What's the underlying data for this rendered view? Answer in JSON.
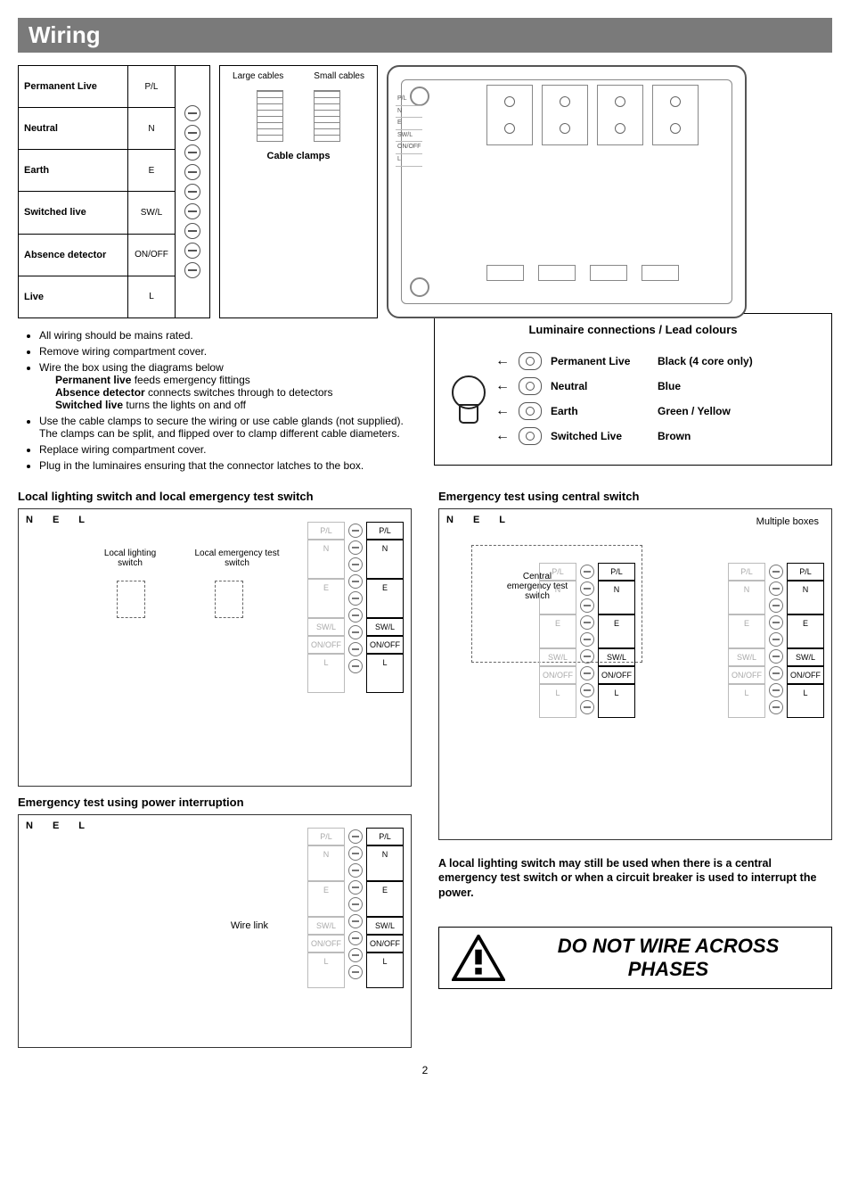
{
  "title": "Wiring",
  "page_number": "2",
  "terminals": [
    {
      "label": "Permanent Live",
      "abbr": "P/L"
    },
    {
      "label": "Neutral",
      "abbr": "N"
    },
    {
      "label": "Earth",
      "abbr": "E"
    },
    {
      "label": "Switched live",
      "abbr": "SW/L"
    },
    {
      "label": "Absence detector",
      "abbr": "ON/OFF"
    },
    {
      "label": "Live",
      "abbr": "L"
    }
  ],
  "clamp": {
    "large": "Large cables",
    "small": "Small cables",
    "title": "Cable clamps"
  },
  "bullets": [
    "All wiring should be mains rated.",
    "Remove wiring compartment cover.",
    "Wire the box using the diagrams below",
    "Use the cable clamps to secure the wiring or use cable glands (not supplied). The clamps can be split, and flipped over to clamp different cable diameters.",
    "Replace wiring compartment cover.",
    "Plug in the luminaires ensuring that the connector latches to the box."
  ],
  "sub_bullets": [
    {
      "bold": "Permanent live",
      "rest": " feeds emergency fittings"
    },
    {
      "bold": "Absence detector",
      "rest": " connects switches through to detectors"
    },
    {
      "bold": "Switched live",
      "rest": " turns the lights on and off"
    }
  ],
  "luminaire": {
    "title": "Luminaire connections / Lead colours",
    "rows": [
      {
        "name": "Permanent Live",
        "color": "Black (4 core only)"
      },
      {
        "name": "Neutral",
        "color": "Blue"
      },
      {
        "name": "Earth",
        "color": "Green / Yellow"
      },
      {
        "name": "Switched Live",
        "color": "Brown"
      }
    ]
  },
  "sections": {
    "local": "Local lighting switch and local emergency test switch",
    "interruption": "Emergency test using power interruption",
    "central": "Emergency test using central switch"
  },
  "rails": [
    "N",
    "E",
    "L"
  ],
  "term_labels": [
    "P/L",
    "N",
    "E",
    "SW/L",
    "ON/OFF",
    "L"
  ],
  "switch_labels": {
    "local_light": "Local lighting switch",
    "local_em": "Local emergency test switch",
    "wire_link": "Wire link",
    "central": "Central emergency test switch",
    "multi": "Multiple boxes"
  },
  "note": "A local lighting switch may still be used when there is a central emergency test switch or when a circuit breaker is  used to interrupt the power.",
  "warning": "DO NOT WIRE ACROSS PHASES"
}
